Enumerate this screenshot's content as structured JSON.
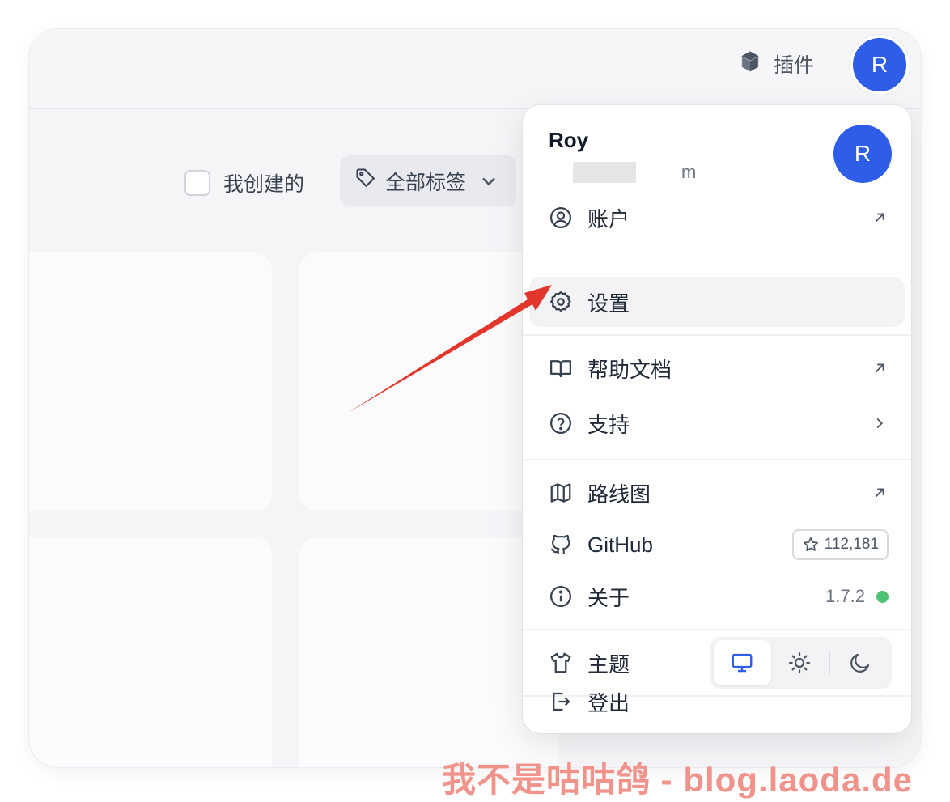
{
  "topbar": {
    "plugins_label": "插件",
    "avatar_letter": "R"
  },
  "filters": {
    "my_created_label": "我创建的",
    "tags_label": "全部标签"
  },
  "user_menu": {
    "name": "Roy",
    "email_visible": "m",
    "avatar_letter": "R",
    "items": {
      "account": "账户",
      "settings": "设置",
      "docs": "帮助文档",
      "support": "支持",
      "roadmap": "路线图",
      "github": "GitHub",
      "github_stars": "112,181",
      "about": "关于",
      "version": "1.7.2",
      "theme": "主题",
      "logout": "登出"
    }
  },
  "colors": {
    "accent": "#2e5de8",
    "status_dot": "#4ec373",
    "arrow": "#e2352b"
  },
  "watermark": "我不是咕咕鸽 - blog.laoda.de"
}
